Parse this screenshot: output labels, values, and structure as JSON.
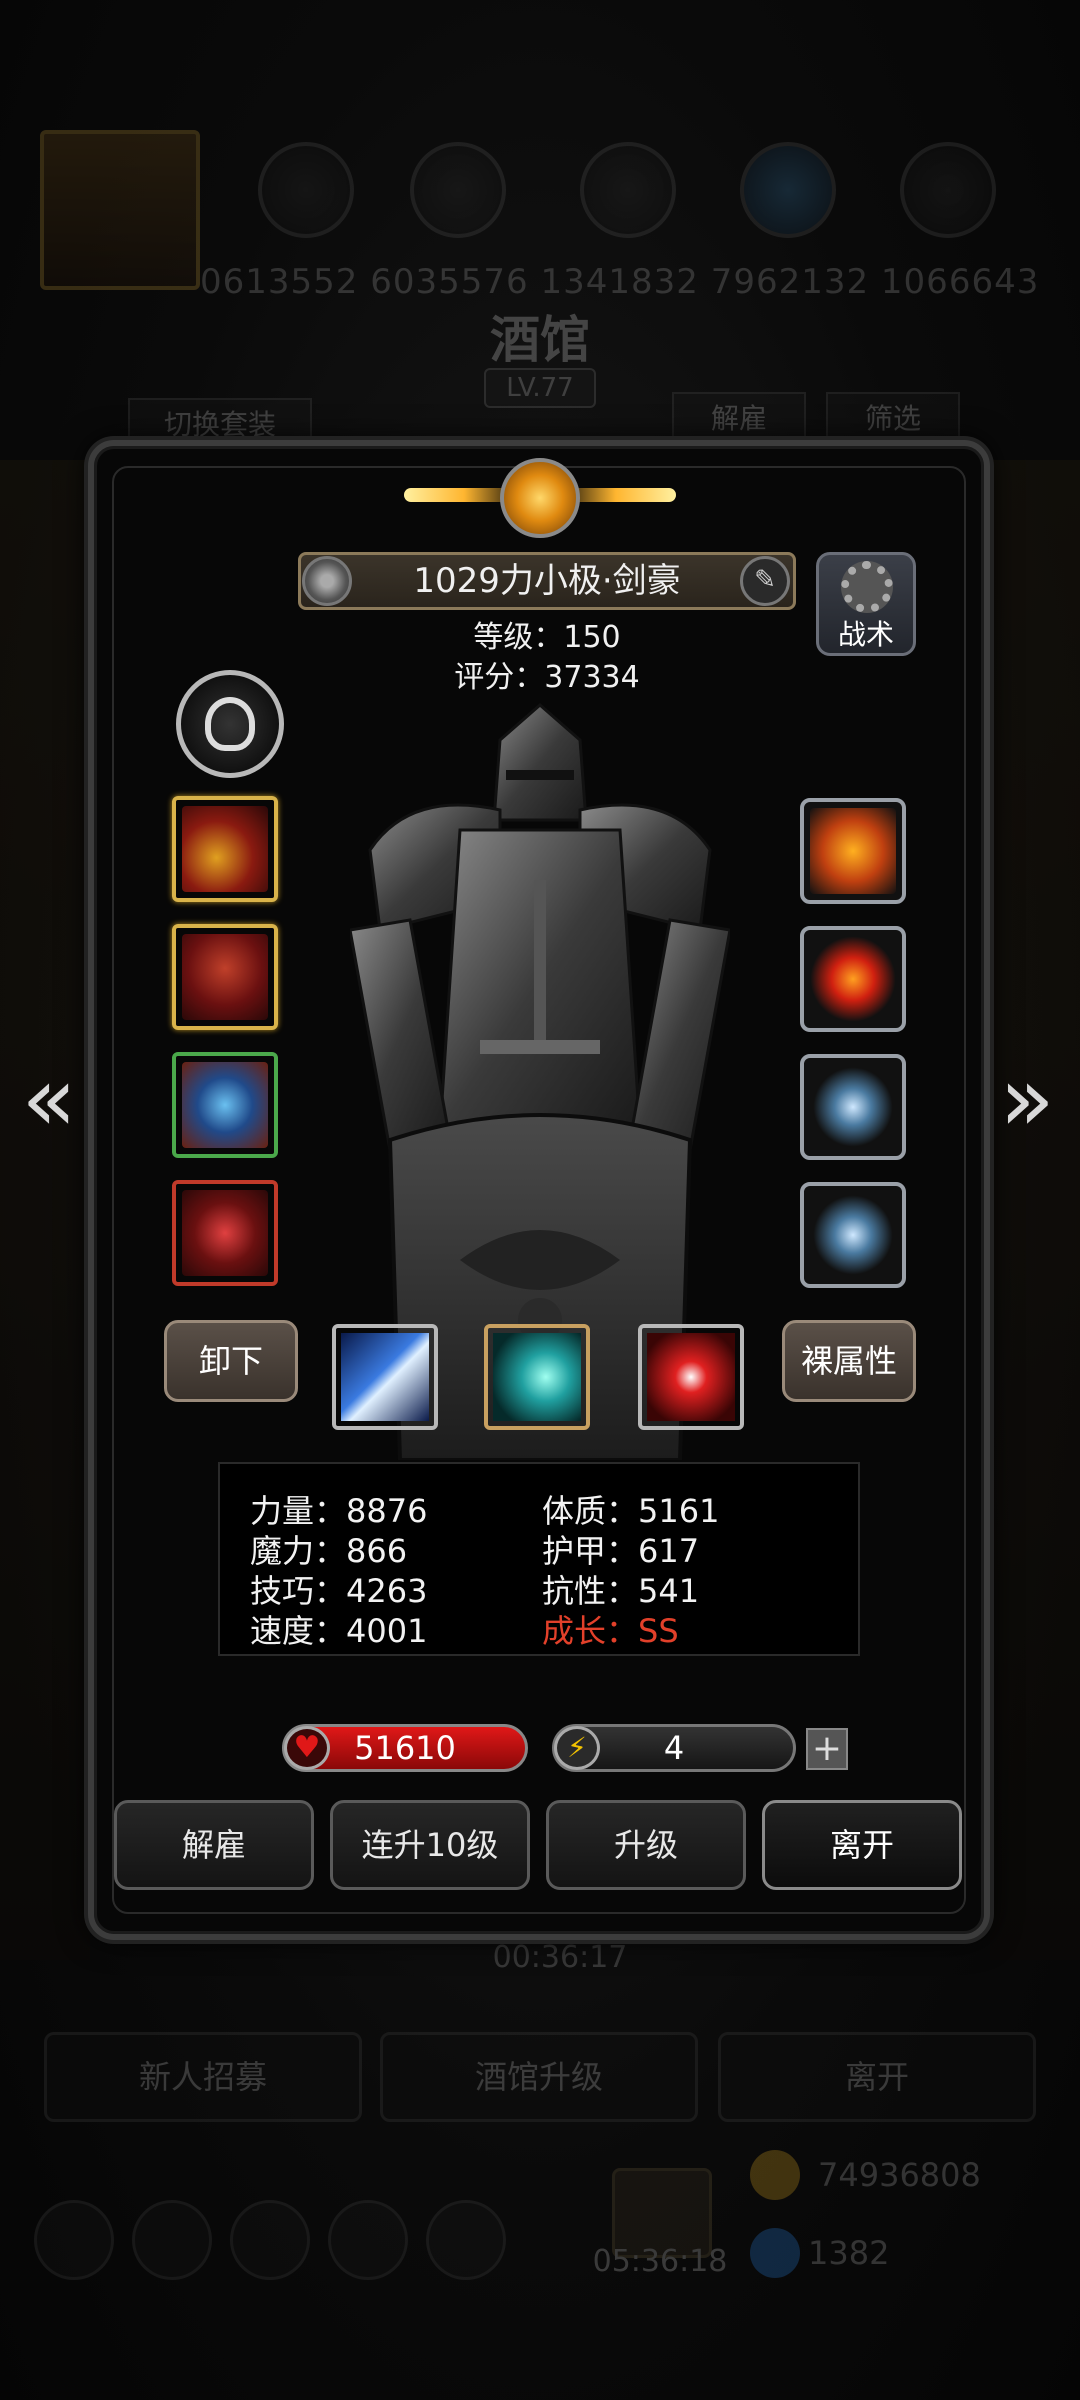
{
  "background": {
    "resource_numbers": "0613552  6035576  1341832  7962132  1066643",
    "title": "酒馆",
    "level": "LV.77",
    "switch_set_label": "切换套装",
    "dismiss_label": "解雇",
    "filter_label": "筛选",
    "bottom_buttons": [
      "新人招募",
      "酒馆升级",
      "离开"
    ],
    "timer": "00:36:17",
    "gift_timer": "05:36:18",
    "coins": "74936808",
    "gems": "1382",
    "colors": {
      "coin": "#d4a020",
      "gem": "#2a7ad4"
    }
  },
  "hero": {
    "name": "1029力小极·剑豪",
    "level_label": "等级",
    "level": "150",
    "score_label": "评分",
    "score": "37334",
    "tactics_label": "战术",
    "unequip_label": "卸下",
    "naked_attr_label": "裸属性"
  },
  "stats": {
    "left": [
      {
        "label": "力量",
        "value": "8876"
      },
      {
        "label": "魔力",
        "value": "866"
      },
      {
        "label": "技巧",
        "value": "4263"
      },
      {
        "label": "速度",
        "value": "4001"
      }
    ],
    "right": [
      {
        "label": "体质",
        "value": "5161"
      },
      {
        "label": "护甲",
        "value": "617"
      },
      {
        "label": "抗性",
        "value": "541"
      },
      {
        "label": "成长",
        "value": "SS"
      }
    ],
    "separator": "：",
    "growth_color": "#e2402a"
  },
  "bars": {
    "hp": "51610",
    "energy": "4",
    "plus": "+"
  },
  "actions": {
    "dismiss": "解雇",
    "level_up_10": "连升10级",
    "level_up": "升级",
    "leave": "离开"
  },
  "icons": {
    "left_arrow": "«",
    "right_arrow": "»",
    "heart": "♥",
    "bolt": "⚡",
    "edit": "✎"
  }
}
